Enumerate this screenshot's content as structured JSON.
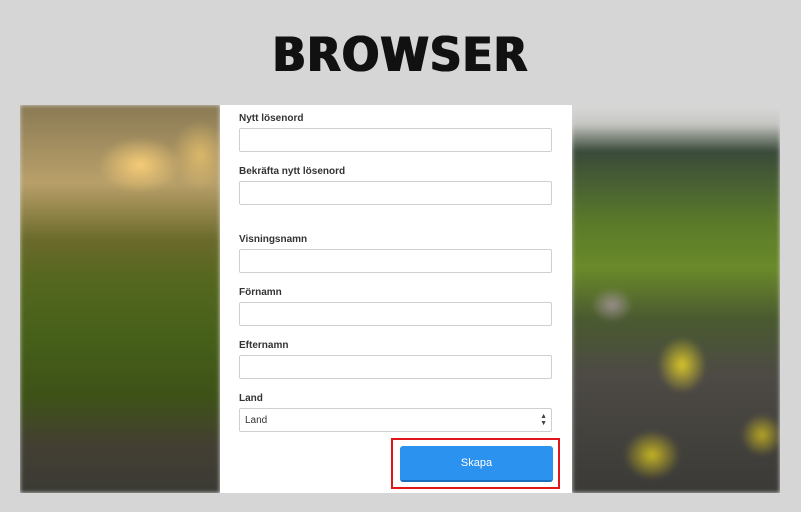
{
  "header": {
    "logo": "BROWSER"
  },
  "form": {
    "new_password": {
      "label": "Nytt lösenord",
      "value": ""
    },
    "confirm_password": {
      "label": "Bekräfta nytt lösenord",
      "value": ""
    },
    "display_name": {
      "label": "Visningsnamn",
      "value": ""
    },
    "first_name": {
      "label": "Förnamn",
      "value": ""
    },
    "last_name": {
      "label": "Efternamn",
      "value": ""
    },
    "country": {
      "label": "Land",
      "selected": "Land"
    },
    "submit_label": "Skapa"
  },
  "colors": {
    "button": "#2b92f0",
    "highlight": "#e0161a"
  }
}
